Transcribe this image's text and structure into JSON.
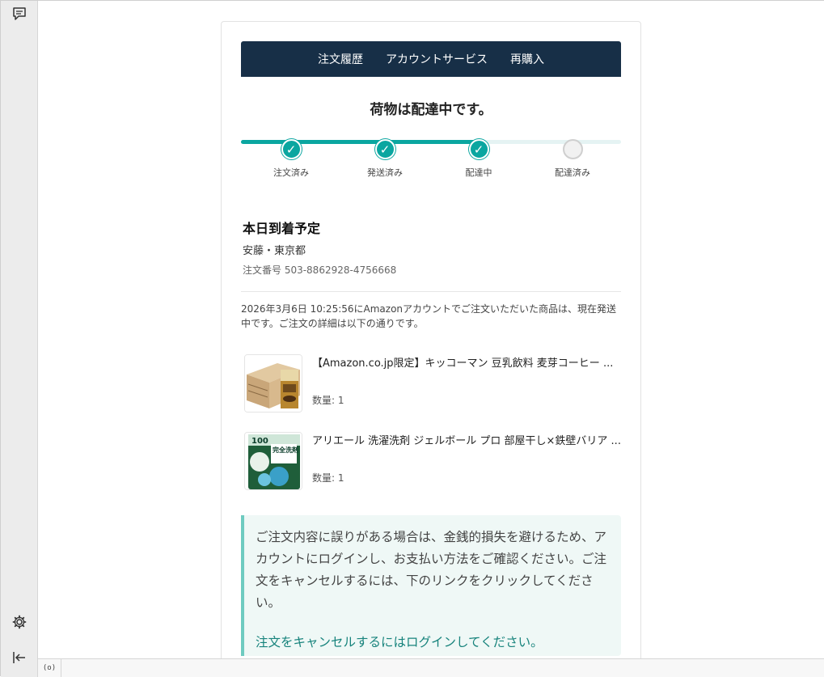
{
  "sidebar": {
    "top_icon": "chat-bubble-icon",
    "settings_icon": "gear-icon",
    "collapse_icon": "collapse-left-icon"
  },
  "statusbar": {
    "indicator": "(o)"
  },
  "email": {
    "nav": [
      {
        "label": "注文履歴"
      },
      {
        "label": "アカウントサービス"
      },
      {
        "label": "再購入"
      }
    ],
    "status_title": "荷物は配達中です。",
    "progress": {
      "completed_fraction": 0.63,
      "steps": [
        {
          "label": "注文済み",
          "done": true,
          "check": "✓"
        },
        {
          "label": "発送済み",
          "done": true,
          "check": "✓"
        },
        {
          "label": "配達中",
          "done": true,
          "check": "✓"
        },
        {
          "label": "配達済み",
          "done": false,
          "check": ""
        }
      ]
    },
    "delivery_title": "本日到着予定",
    "recipient": "安藤・東京都",
    "order_number": "注文番号 503-8862928-4756668",
    "description": "2026年3月6日 10:25:56にAmazonアカウントでご注文いただいた商品は、現在発送中です。ご注文の詳細は以下の通りです。",
    "items": [
      {
        "title": "【Amazon.co.jp限定】キッコーマン 豆乳飲料 麦芽コーヒー ...",
        "qty": "数量: 1"
      },
      {
        "title": "アリエール 洗濯洗剤 ジェルボール プロ 部屋干し×鉄壁バリア ...",
        "qty": "数量: 1",
        "badge": "100",
        "pack_text": "完全洗剤"
      }
    ],
    "notice_text": "ご注文内容に誤りがある場合は、金銭的損失を避けるため、アカウントにログインし、お支払い方法をご確認ください。ご注文をキャンセルするには、下のリンクをクリックしてください。",
    "notice_link": "注文をキャンセルするにはログインしてください。"
  },
  "colors": {
    "nav_bg": "#172f47",
    "accent": "#0aa6a0",
    "notice_bg": "#eff8f6",
    "link": "#17837c"
  }
}
